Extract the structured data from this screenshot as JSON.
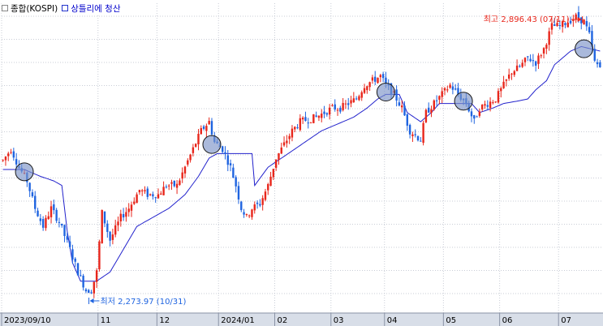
{
  "legend": {
    "series_name": "종합(KOSPI)",
    "indicator_name": "상틀리에 청산"
  },
  "colors": {
    "up": "#e8261b",
    "down": "#1f64e0",
    "indicator_line": "#2222cc",
    "circle_fill": "#7d94c8",
    "grid": "#c9cdd6",
    "axis_bg": "#d8dee8",
    "annotation_high": "#e8261b",
    "annotation_low": "#1f64e0"
  },
  "chart_data": {
    "type": "candlestick",
    "x_axis_labels": [
      {
        "label": "2023/09/10",
        "index": 0
      },
      {
        "label": "11",
        "index": 36
      },
      {
        "label": "12",
        "index": 58
      },
      {
        "label": "2024/01",
        "index": 81
      },
      {
        "label": "02",
        "index": 102
      },
      {
        "label": "03",
        "index": 123
      },
      {
        "label": "04",
        "index": 143
      },
      {
        "label": "05",
        "index": 165
      },
      {
        "label": "06",
        "index": 186
      },
      {
        "label": "07",
        "index": 208
      }
    ],
    "ylim": [
      2240,
      2920
    ],
    "grid": true,
    "annotations": {
      "high": {
        "text": "최고 2,896.43 (07/11)",
        "index": 214,
        "value": 2896.43
      },
      "low": {
        "text": "최저 2,273.97 (10/31)",
        "index": 33,
        "value": 2273.97
      }
    },
    "anchors": [
      [
        0,
        2575
      ],
      [
        3,
        2600
      ],
      [
        6,
        2560
      ],
      [
        9,
        2530
      ],
      [
        12,
        2470
      ],
      [
        15,
        2430
      ],
      [
        18,
        2470
      ],
      [
        21,
        2440
      ],
      [
        25,
        2380
      ],
      [
        28,
        2330
      ],
      [
        31,
        2290
      ],
      [
        33,
        2290
      ],
      [
        35,
        2330
      ],
      [
        37,
        2460
      ],
      [
        40,
        2400
      ],
      [
        44,
        2450
      ],
      [
        47,
        2470
      ],
      [
        51,
        2510
      ],
      [
        54,
        2500
      ],
      [
        58,
        2500
      ],
      [
        61,
        2520
      ],
      [
        65,
        2520
      ],
      [
        68,
        2560
      ],
      [
        71,
        2600
      ],
      [
        74,
        2640
      ],
      [
        77,
        2660
      ],
      [
        79,
        2615
      ],
      [
        82,
        2600
      ],
      [
        85,
        2560
      ],
      [
        87,
        2520
      ],
      [
        89,
        2470
      ],
      [
        91,
        2450
      ],
      [
        93,
        2470
      ],
      [
        96,
        2480
      ],
      [
        99,
        2520
      ],
      [
        102,
        2580
      ],
      [
        105,
        2610
      ],
      [
        108,
        2640
      ],
      [
        111,
        2660
      ],
      [
        114,
        2665
      ],
      [
        117,
        2670
      ],
      [
        120,
        2680
      ],
      [
        123,
        2690
      ],
      [
        126,
        2690
      ],
      [
        129,
        2700
      ],
      [
        132,
        2710
      ],
      [
        135,
        2740
      ],
      [
        138,
        2750
      ],
      [
        141,
        2760
      ],
      [
        143,
        2740
      ],
      [
        146,
        2720
      ],
      [
        149,
        2690
      ],
      [
        152,
        2640
      ],
      [
        154,
        2630
      ],
      [
        156,
        2620
      ],
      [
        158,
        2680
      ],
      [
        161,
        2700
      ],
      [
        164,
        2720
      ],
      [
        167,
        2740
      ],
      [
        170,
        2720
      ],
      [
        173,
        2700
      ],
      [
        176,
        2660
      ],
      [
        178,
        2690
      ],
      [
        181,
        2700
      ],
      [
        184,
        2710
      ],
      [
        187,
        2740
      ],
      [
        190,
        2770
      ],
      [
        193,
        2780
      ],
      [
        196,
        2800
      ],
      [
        199,
        2790
      ],
      [
        202,
        2820
      ],
      [
        205,
        2870
      ],
      [
        208,
        2870
      ],
      [
        211,
        2880
      ],
      [
        214,
        2890
      ],
      [
        217,
        2880
      ],
      [
        219,
        2850
      ],
      [
        221,
        2790
      ],
      [
        223,
        2780
      ]
    ],
    "indicator_anchors": [
      [
        0,
        2555
      ],
      [
        8,
        2555
      ],
      [
        14,
        2540
      ],
      [
        19,
        2530
      ],
      [
        22,
        2520
      ],
      [
        24,
        2420
      ],
      [
        26,
        2350
      ],
      [
        29,
        2310
      ],
      [
        35,
        2310
      ],
      [
        40,
        2330
      ],
      [
        45,
        2380
      ],
      [
        50,
        2430
      ],
      [
        56,
        2450
      ],
      [
        62,
        2470
      ],
      [
        68,
        2500
      ],
      [
        73,
        2540
      ],
      [
        77,
        2580
      ],
      [
        80,
        2590
      ],
      [
        84,
        2590
      ],
      [
        93,
        2590
      ],
      [
        94,
        2520
      ],
      [
        99,
        2560
      ],
      [
        104,
        2580
      ],
      [
        109,
        2600
      ],
      [
        114,
        2620
      ],
      [
        119,
        2640
      ],
      [
        125,
        2655
      ],
      [
        131,
        2670
      ],
      [
        136,
        2690
      ],
      [
        140,
        2710
      ],
      [
        143,
        2720
      ],
      [
        148,
        2720
      ],
      [
        151,
        2680
      ],
      [
        156,
        2660
      ],
      [
        160,
        2680
      ],
      [
        163,
        2700
      ],
      [
        168,
        2700
      ],
      [
        175,
        2700
      ],
      [
        178,
        2680
      ],
      [
        183,
        2690
      ],
      [
        187,
        2700
      ],
      [
        192,
        2705
      ],
      [
        196,
        2710
      ],
      [
        199,
        2730
      ],
      [
        203,
        2750
      ],
      [
        206,
        2785
      ],
      [
        209,
        2800
      ],
      [
        212,
        2815
      ],
      [
        216,
        2825
      ],
      [
        223,
        2815
      ]
    ],
    "exit_signals": [
      {
        "index": 8,
        "value": 2550
      },
      {
        "index": 78,
        "value": 2610
      },
      {
        "index": 143,
        "value": 2725
      },
      {
        "index": 172,
        "value": 2705
      },
      {
        "index": 217,
        "value": 2820
      }
    ]
  }
}
